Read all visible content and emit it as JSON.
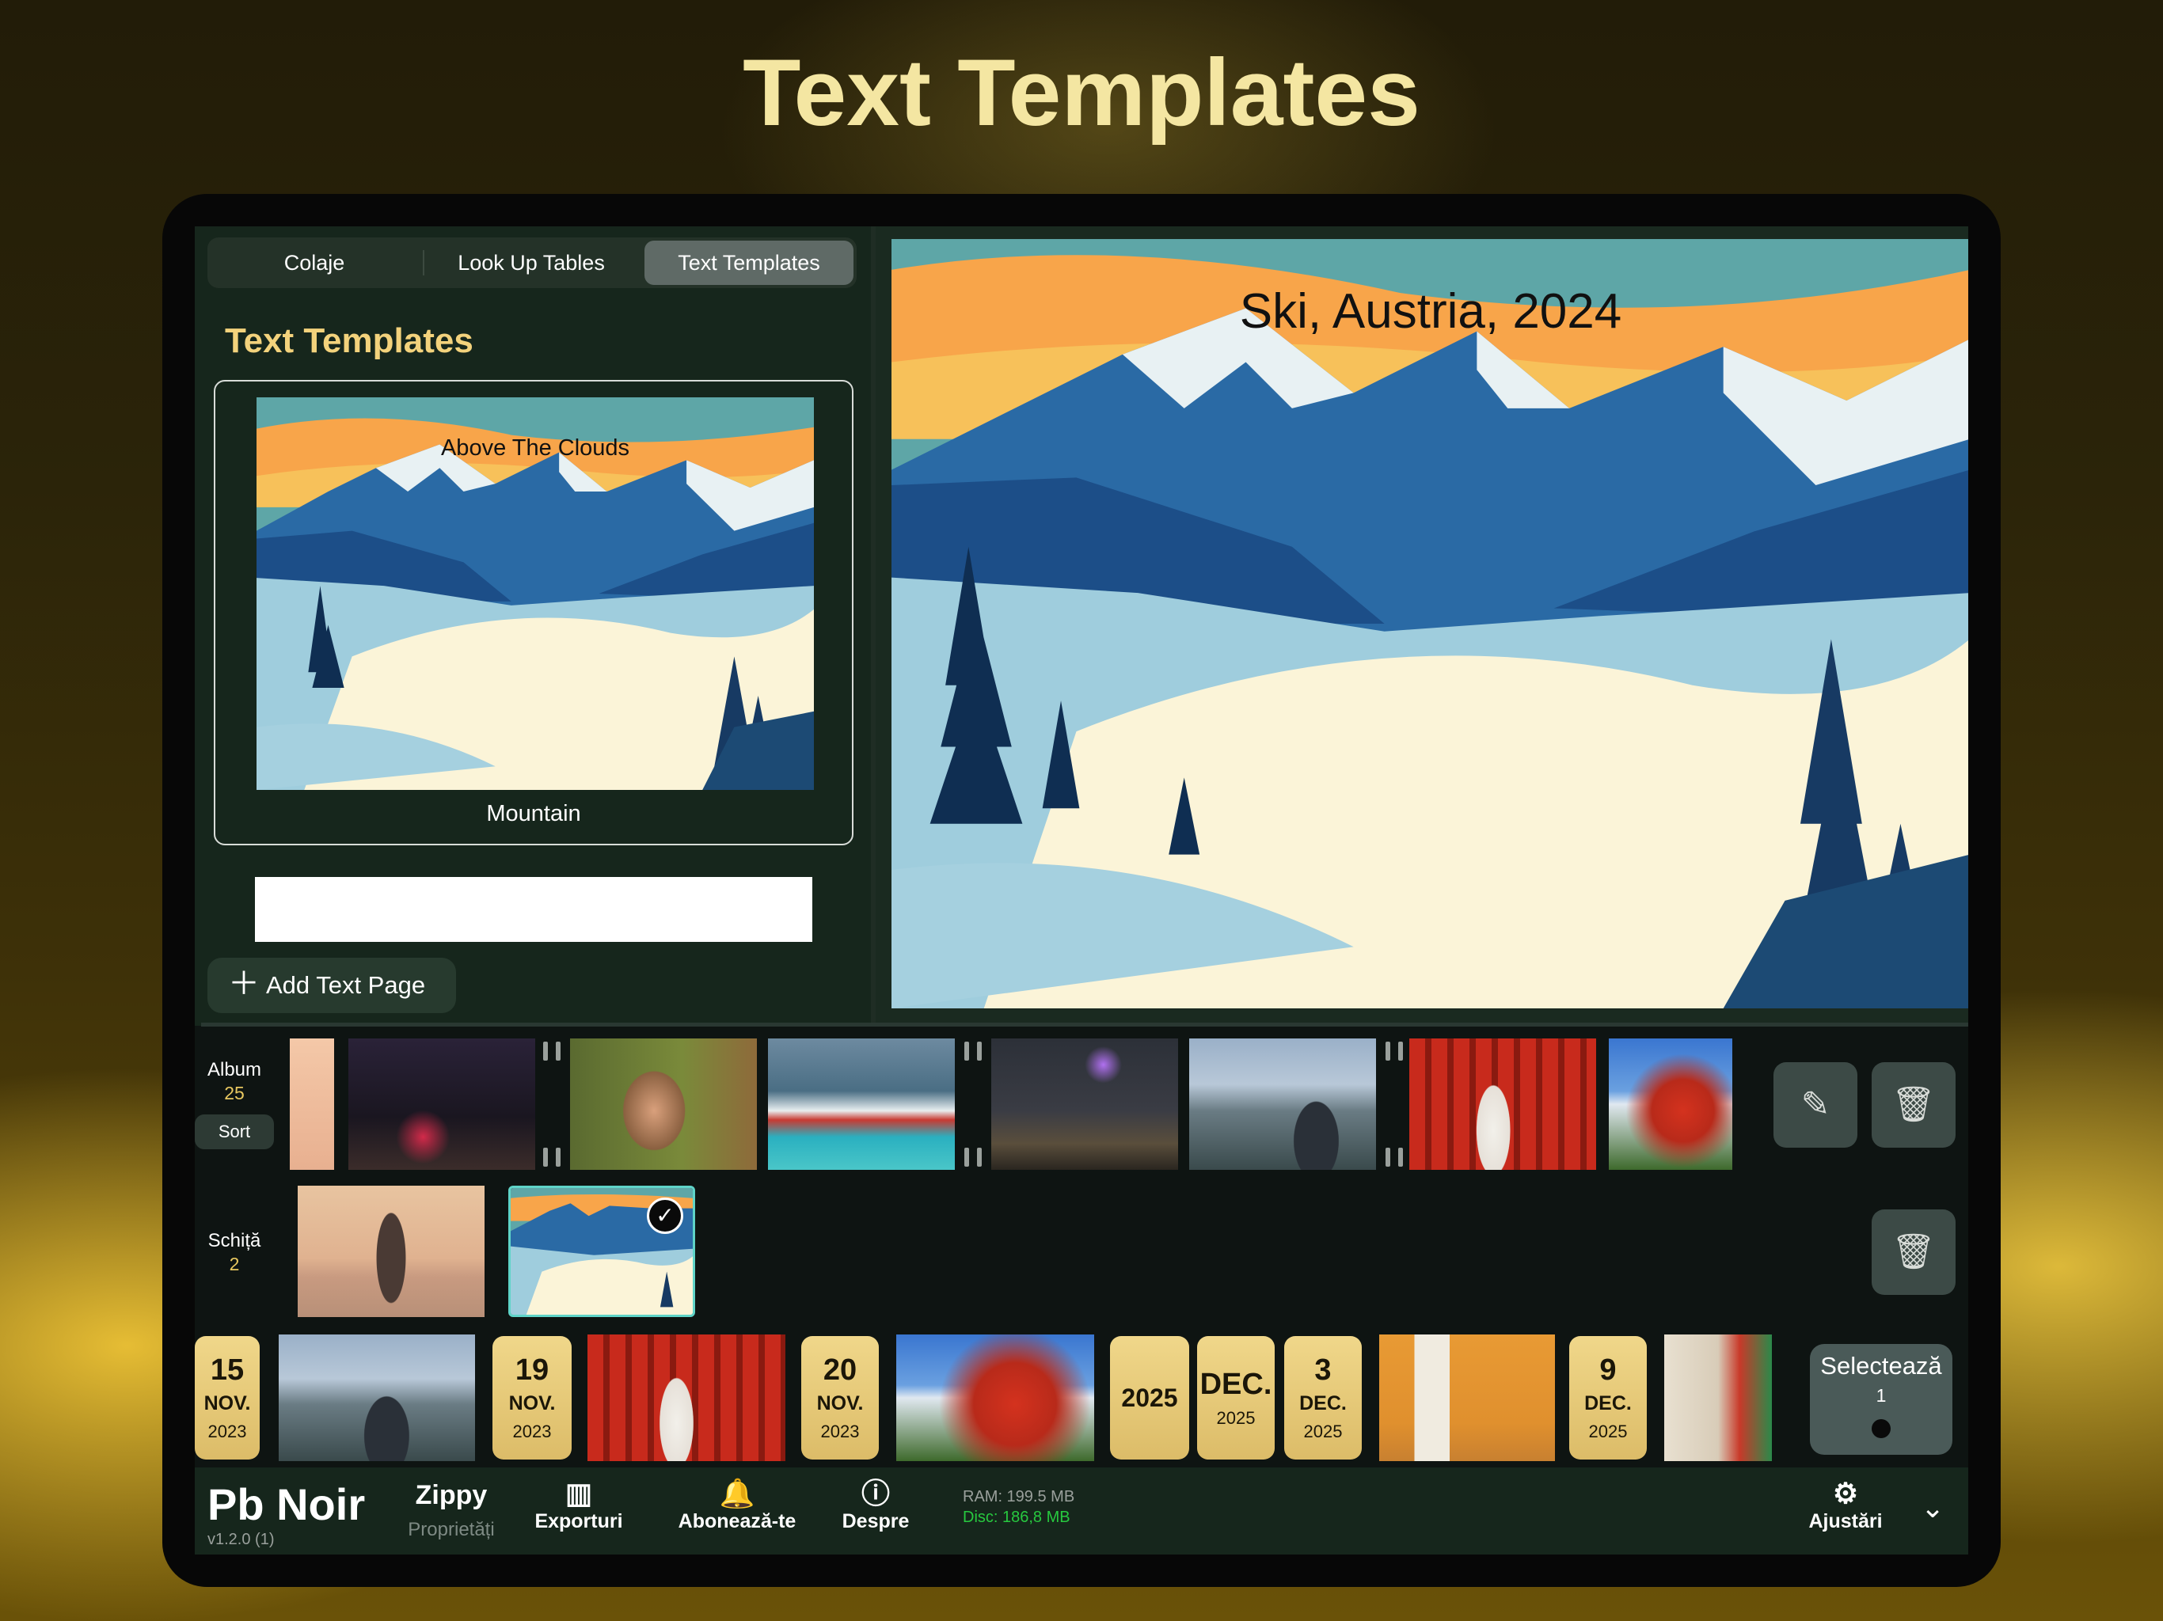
{
  "headline": "Text Templates",
  "tabs": [
    {
      "label": "Colaje",
      "selected": false
    },
    {
      "label": "Look Up Tables",
      "selected": false
    },
    {
      "label": "Text Templates",
      "selected": true
    }
  ],
  "panel": {
    "title": "Text Templates",
    "template": {
      "overlay_text": "Above The Clouds",
      "name": "Mountain"
    },
    "add_button": "Add Text Page"
  },
  "preview": {
    "overlay_text": "Ski, Austria, 2024"
  },
  "album": {
    "label": "Album",
    "count": "25",
    "sort_label": "Sort"
  },
  "draft": {
    "label": "Schiță",
    "count": "2"
  },
  "timeline": {
    "dates": [
      {
        "day": "15",
        "month": "NOV.",
        "year": "2023"
      },
      {
        "day": "19",
        "month": "NOV.",
        "year": "2023"
      },
      {
        "day": "20",
        "month": "NOV.",
        "year": "2023"
      },
      {
        "year_only": "2025"
      },
      {
        "month": "DEC.",
        "year": "2025"
      },
      {
        "day": "3",
        "month": "DEC.",
        "year": "2025"
      },
      {
        "day": "9",
        "month": "DEC.",
        "year": "2025"
      }
    ],
    "select_label": "Selectează",
    "select_count": "1"
  },
  "toolbar": {
    "app_name": "Pb Noir",
    "version": "v1.2.0 (1)",
    "project_name": "Zippy",
    "project_sub": "Proprietăți",
    "exports": "Exporturi",
    "subscribe": "Abonează-te",
    "about": "Despre",
    "ram": "RAM: 199.5 MB",
    "disk": "Disc: 186,8 MB",
    "settings": "Ajustări"
  },
  "colors": {
    "accent": "#f3d27c",
    "panel": "#16261c",
    "date_tile": "#e8ca78",
    "mem_ram": "#9aa09c",
    "mem_disk": "#27c93f"
  }
}
